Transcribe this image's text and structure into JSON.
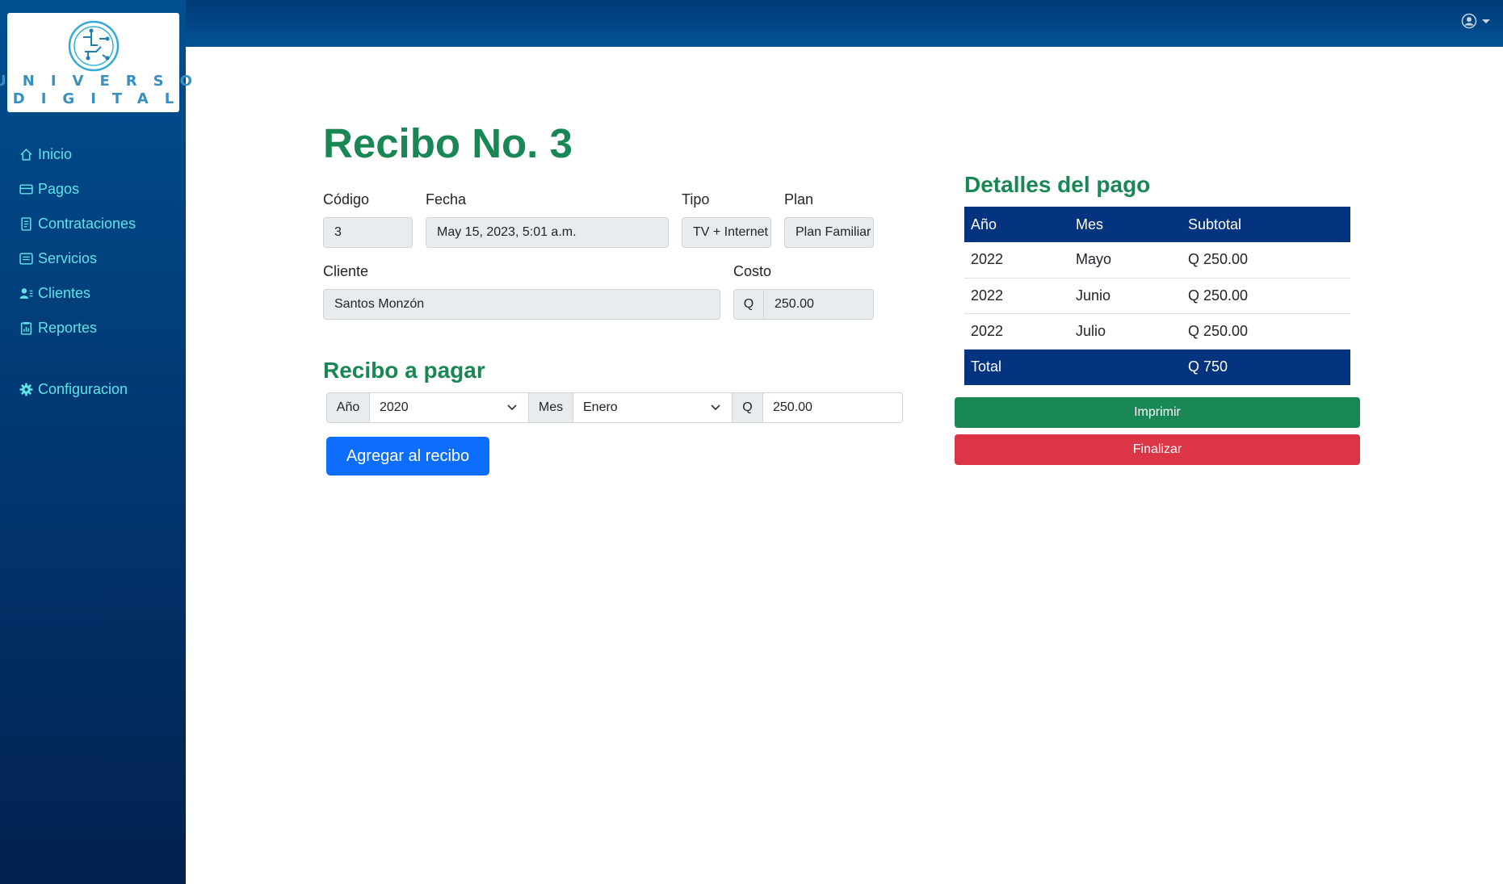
{
  "brand": {
    "logo_line1": "UNIVERSO",
    "logo_line2": "DIGITAL"
  },
  "sidebar": {
    "items": [
      {
        "label": "Inicio",
        "icon": "home-icon"
      },
      {
        "label": "Pagos",
        "icon": "credit-card-icon"
      },
      {
        "label": "Contrataciones",
        "icon": "document-icon"
      },
      {
        "label": "Servicios",
        "icon": "list-card-icon"
      },
      {
        "label": "Clientes",
        "icon": "users-icon"
      },
      {
        "label": "Reportes",
        "icon": "report-icon"
      },
      {
        "label": "Configuracion",
        "icon": "gear-icon"
      }
    ]
  },
  "topbar": {
    "user_icon": "user-circle-icon"
  },
  "receipt": {
    "title": "Recibo No. 3",
    "codigo_label": "Código",
    "codigo_value": "3",
    "fecha_label": "Fecha",
    "fecha_value": "May 15, 2023, 5:01 a.m.",
    "tipo_label": "Tipo",
    "tipo_value": "TV + Internet",
    "plan_label": "Plan",
    "plan_value": "Plan Familiar",
    "cliente_label": "Cliente",
    "cliente_value": "Santos Monzón",
    "costo_label": "Costo",
    "costo_currency": "Q",
    "costo_value": "250.00"
  },
  "pay_form": {
    "title": "Recibo a pagar",
    "year_label": "Año",
    "year_value": "2020",
    "month_label": "Mes",
    "month_value": "Enero",
    "amount_currency": "Q",
    "amount_value": "250.00",
    "add_button": "Agregar al recibo"
  },
  "details": {
    "title": "Detalles del pago",
    "headers": [
      "Año",
      "Mes",
      "Subtotal"
    ],
    "rows": [
      [
        "2022",
        "Mayo",
        "Q 250.00"
      ],
      [
        "2022",
        "Junio",
        "Q 250.00"
      ],
      [
        "2022",
        "Julio",
        "Q 250.00"
      ]
    ],
    "total_label": "Total",
    "total_value": "Q 750"
  },
  "actions": {
    "print": "Imprimir",
    "finish": "Finalizar"
  },
  "colors": {
    "accent_green": "#198754",
    "primary": "#0d6efd",
    "danger": "#dc3545",
    "table_head": "#04337f",
    "nav_text": "#5ee4ea"
  }
}
